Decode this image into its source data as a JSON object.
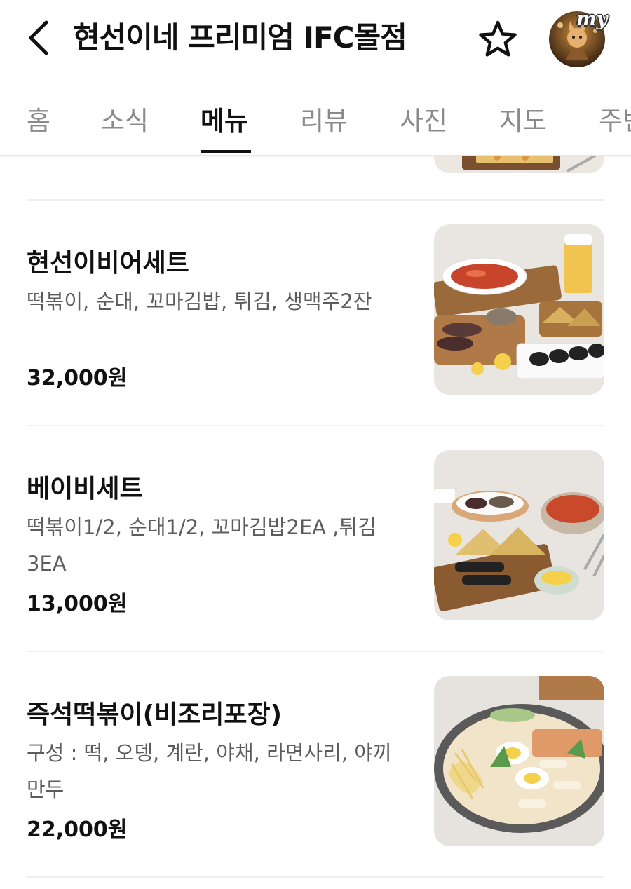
{
  "header": {
    "title": "현선이네 프리미엄 IFC몰점",
    "back_icon": "chevron-left-icon",
    "favorite_icon": "star-outline-icon",
    "avatar_badge": "my"
  },
  "tabs": [
    {
      "label": "홈",
      "active": false
    },
    {
      "label": "소식",
      "active": false
    },
    {
      "label": "메뉴",
      "active": true
    },
    {
      "label": "리뷰",
      "active": false
    },
    {
      "label": "사진",
      "active": false
    },
    {
      "label": "지도",
      "active": false
    },
    {
      "label": "주변",
      "active": false
    }
  ],
  "menu": {
    "items": [
      {
        "name": "현선이비어세트",
        "description": "떡볶이, 순대, 꼬마김밥, 튀김, 생맥주2잔",
        "price": "32,000원"
      },
      {
        "name": "베이비세트",
        "description": "떡볶이1/2, 순대1/2, 꼬마김밥2EA ,튀김 3EA",
        "price": "13,000원"
      },
      {
        "name": "즉석떡볶이(비조리포장)",
        "description": "구성 : 떡, 오뎅, 계란, 야채, 라면사리, 야끼만두",
        "price": "22,000원"
      }
    ]
  },
  "colors": {
    "text_primary": "#111111",
    "text_secondary": "#5c5c5c",
    "tab_inactive": "#8a8a8a",
    "divider": "#f0f0f0"
  }
}
